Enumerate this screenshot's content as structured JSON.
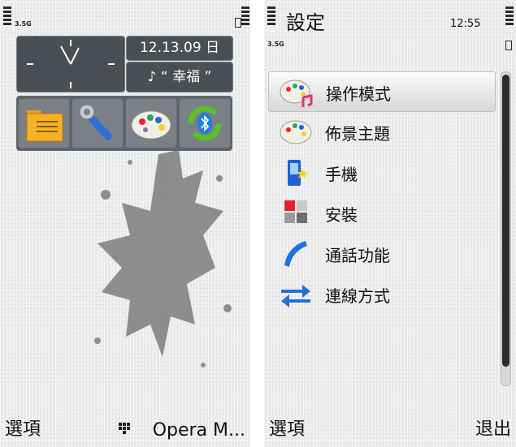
{
  "home": {
    "status": {
      "network": "3.5G"
    },
    "date": "12.13.09 日",
    "music_text": "“ 幸福 ”",
    "music_icon": "music-note-icon",
    "shortcuts": [
      "file-manager-icon",
      "tools-wrench-icon",
      "themes-palette-icon",
      "bluetooth-sync-icon"
    ],
    "softkeys": {
      "left": "選項",
      "right": "Opera M..."
    }
  },
  "settings": {
    "title": "設定",
    "time": "12:55",
    "status": {
      "network": "3.5G"
    },
    "menu": [
      {
        "label": "操作模式",
        "icon": "profiles-palette-icon",
        "selected": true
      },
      {
        "label": "佈景主題",
        "icon": "themes-palette-icon",
        "selected": false
      },
      {
        "label": "手機",
        "icon": "phone-icon",
        "selected": false
      },
      {
        "label": "安裝",
        "icon": "installations-icon",
        "selected": false
      },
      {
        "label": "通話功能",
        "icon": "call-handset-icon",
        "selected": false
      },
      {
        "label": "連線方式",
        "icon": "connectivity-arrows-icon",
        "selected": false
      }
    ],
    "softkeys": {
      "left": "選項",
      "right": "退出"
    }
  }
}
